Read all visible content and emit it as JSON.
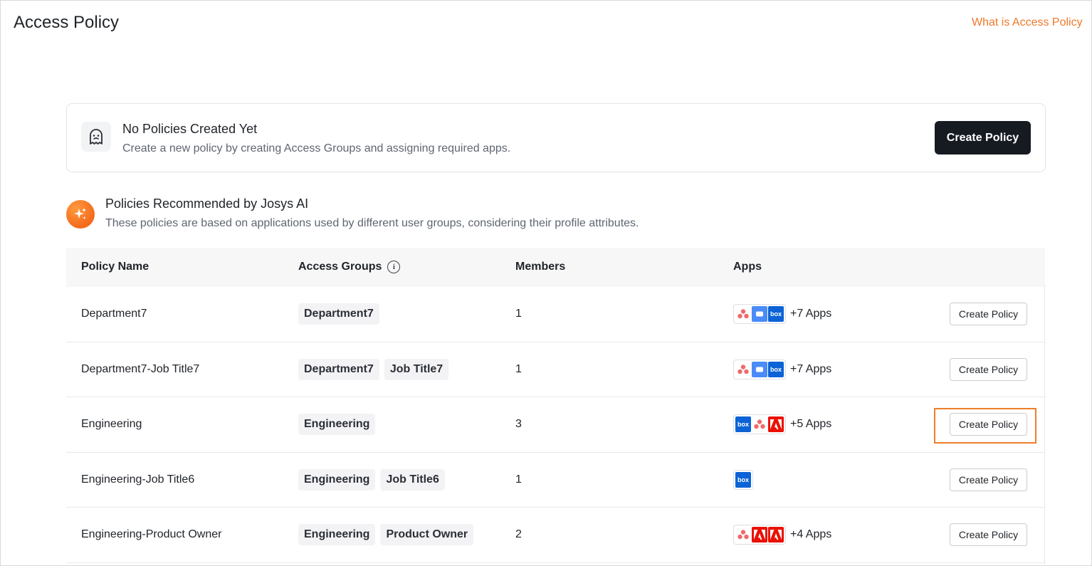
{
  "header": {
    "title": "Access Policy",
    "help_link": "What is Access Policy"
  },
  "empty_state": {
    "icon": "ghost-icon",
    "title": "No Policies Created Yet",
    "subtitle": "Create a new policy by creating Access Groups and assigning required apps.",
    "button": "Create Policy"
  },
  "recommended": {
    "icon": "sparkle-icon",
    "title": "Policies Recommended by Josys AI",
    "subtitle": "These policies are based on applications used by different user groups, considering their profile attributes."
  },
  "table": {
    "columns": {
      "policy_name": "Policy Name",
      "access_groups": "Access Groups",
      "members": "Members",
      "apps": "Apps"
    },
    "rows": [
      {
        "name": "Department7",
        "groups": [
          "Department7"
        ],
        "members": "1",
        "apps": [
          "asana-icon",
          "zoom-icon",
          "box-icon"
        ],
        "more_apps": "+7 Apps",
        "action": "Create Policy"
      },
      {
        "name": "Department7-Job Title7",
        "groups": [
          "Department7",
          "Job Title7"
        ],
        "members": "1",
        "apps": [
          "asana-icon",
          "zoom-icon",
          "box-icon"
        ],
        "more_apps": "+7 Apps",
        "action": "Create Policy"
      },
      {
        "name": "Engineering",
        "groups": [
          "Engineering"
        ],
        "members": "3",
        "apps": [
          "box-icon",
          "asana-icon",
          "adobe-icon"
        ],
        "more_apps": "+5 Apps",
        "action": "Create Policy"
      },
      {
        "name": "Engineering-Job Title6",
        "groups": [
          "Engineering",
          "Job Title6"
        ],
        "members": "1",
        "apps": [
          "box-icon"
        ],
        "more_apps": "",
        "action": "Create Policy"
      },
      {
        "name": "Engineering-Product Owner",
        "groups": [
          "Engineering",
          "Product Owner"
        ],
        "members": "2",
        "apps": [
          "asana-icon",
          "adobe-icon",
          "adobe-icon"
        ],
        "more_apps": "+4 Apps",
        "action": "Create Policy"
      }
    ]
  },
  "app_icon_text": {
    "box": "box"
  },
  "colors": {
    "accent": "#f0782a",
    "primary_button": "#161b22",
    "highlight_border": "#ef7d2a"
  }
}
